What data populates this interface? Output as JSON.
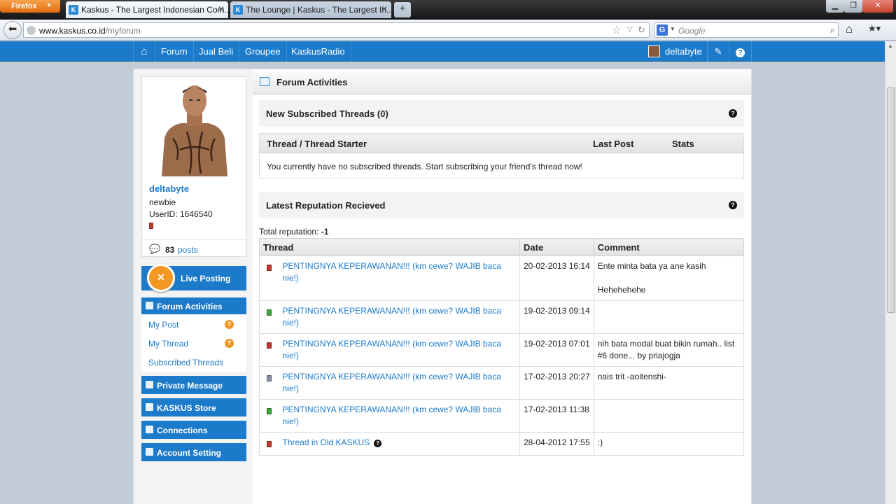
{
  "browser": {
    "menu_label": "Firefox",
    "tabs": [
      {
        "title": "Kaskus - The Largest Indonesian Com...",
        "favicon": "K",
        "active": true
      },
      {
        "title": "The Lounge | Kaskus - The Largest In...",
        "favicon": "K",
        "active": false
      }
    ],
    "new_tab": "+",
    "url_host": "www.kaskus.co.id",
    "url_path": "/myforum",
    "search_engine": "G",
    "search_placeholder": "Google"
  },
  "site_nav": {
    "items": [
      "Forum",
      "Jual Beli",
      "Groupee",
      "KaskusRadio"
    ],
    "username": "deltabyte",
    "accent_color": "#1b7ac9"
  },
  "profile": {
    "username": "deltabyte",
    "rank": "newbie",
    "userid": "UserID: 1646540",
    "post_count": "83",
    "posts_label": "posts"
  },
  "sidebar": {
    "live_posting": "Live Posting",
    "forum_activities": "Forum Activities",
    "sub_items": [
      "My Post",
      "My Thread",
      "Subscribed Threads"
    ],
    "private_message": "Private Message",
    "kaskus_store": "KASKUS Store",
    "connections": "Connections",
    "account_setting": "Account Setting"
  },
  "main": {
    "header_title": "Forum Activities",
    "subscribed": {
      "title": "New Subscribed Threads (0)",
      "columns": [
        "Thread / Thread Starter",
        "Last Post",
        "Stats"
      ],
      "empty_message": "You currently have no subscribed threads. Start subscribing your friend's thread now!"
    },
    "reputation": {
      "title": "Latest Reputation Recieved",
      "total_label": "Total reputation:",
      "total_value": "-1",
      "columns": [
        "Thread",
        "Date",
        "Comment"
      ],
      "rows": [
        {
          "color": "#c0392b",
          "thread": "PENTINGNYA KEPERAWANAN!!! (km cewe? WAJIB baca nie!)",
          "date": "20-02-2013 16:14",
          "comment": "Ente minta bata ya ane kasih\n\nHehehehehe"
        },
        {
          "color": "#3aa63a",
          "thread": "PENTINGNYA KEPERAWANAN!!! (km cewe? WAJIB baca nie!)",
          "date": "19-02-2013 09:14",
          "comment": ""
        },
        {
          "color": "#c0392b",
          "thread": "PENTINGNYA KEPERAWANAN!!! (km cewe? WAJIB baca nie!)",
          "date": "19-02-2013 07:01",
          "comment": "nih bata modal buat bikin rumah.. list #6 done... by priajogja"
        },
        {
          "color": "#8a8fa8",
          "thread": "PENTINGNYA KEPERAWANAN!!! (km cewe? WAJIB baca nie!)",
          "date": "17-02-2013 20:27",
          "comment": "nais trit -aoitenshi-"
        },
        {
          "color": "#3aa63a",
          "thread": "PENTINGNYA KEPERAWANAN!!! (km cewe? WAJIB baca nie!)",
          "date": "17-02-2013 11:38",
          "comment": ""
        },
        {
          "color": "#c0392b",
          "thread": "Thread in Old KASKUS",
          "date": "28-04-2012 17:55",
          "comment": ":)",
          "help": true
        }
      ]
    }
  }
}
